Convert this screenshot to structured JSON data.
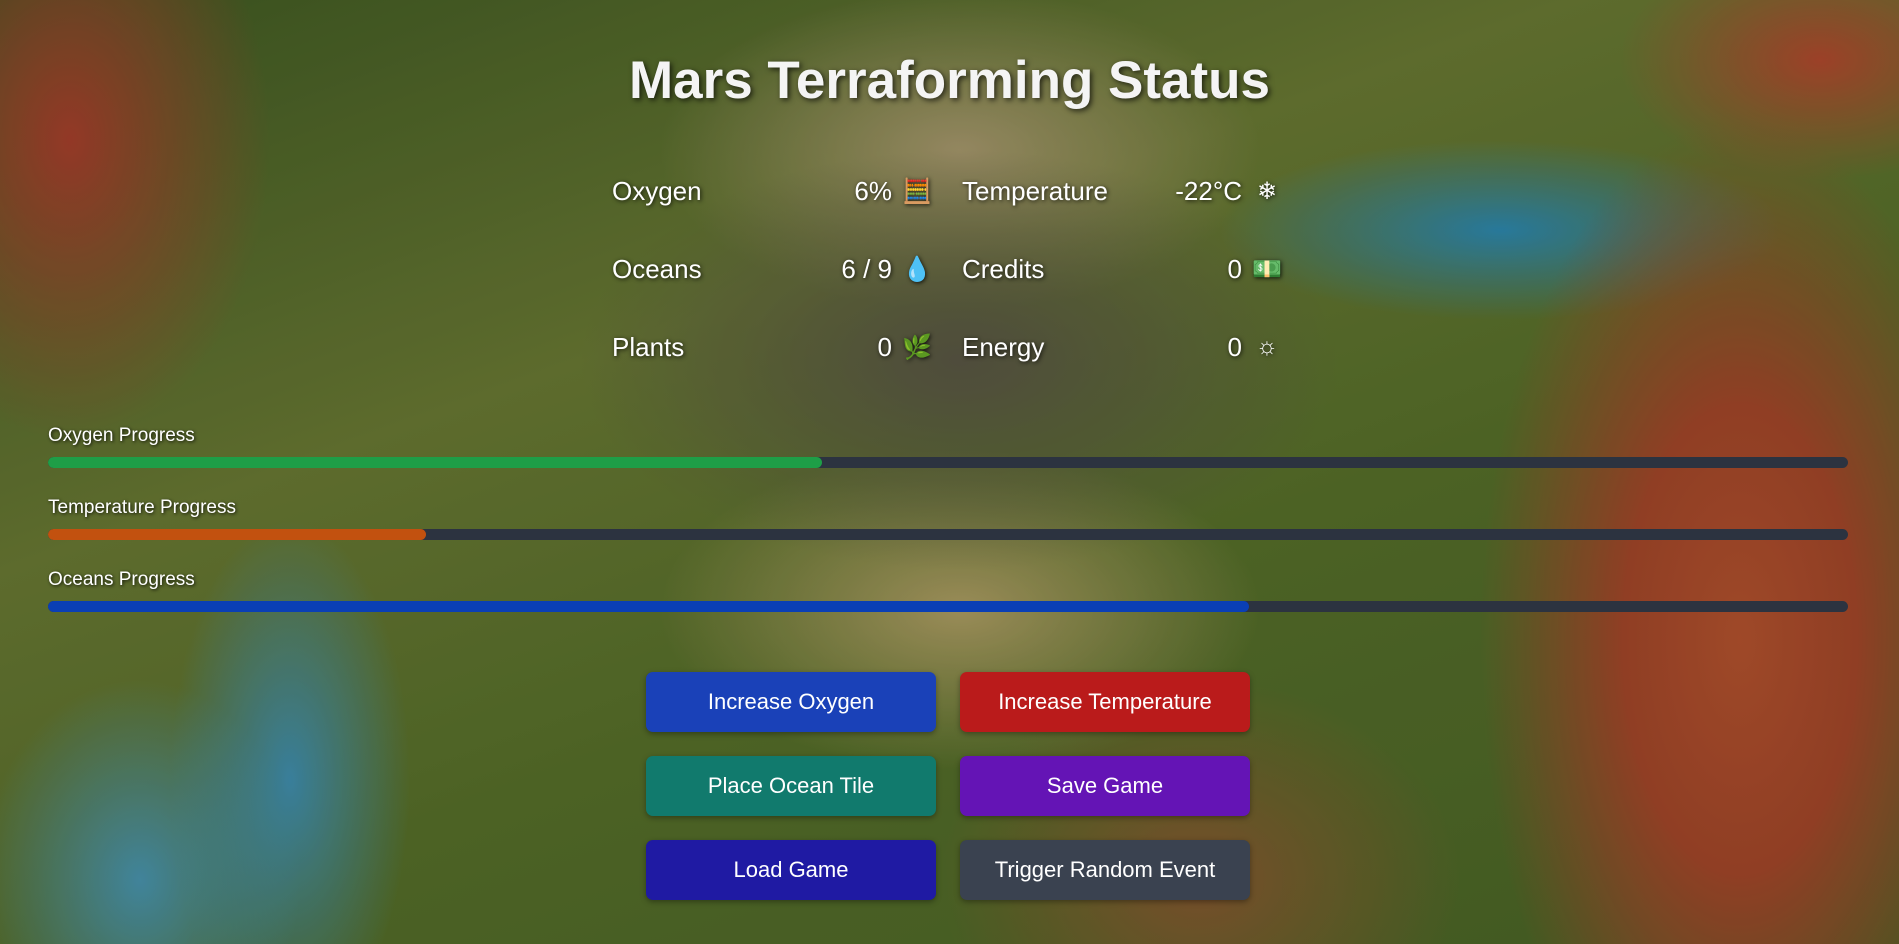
{
  "title": "Mars Terraforming Status",
  "stats": [
    {
      "label": "Oxygen",
      "value": "6%",
      "icon": "🧮",
      "icon_name": "abacus-icon"
    },
    {
      "label": "Temperature",
      "value": "-22°C",
      "icon": "❄",
      "icon_name": "snowflake-icon"
    },
    {
      "label": "Oceans",
      "value": "6 / 9",
      "icon": "💧",
      "icon_name": "droplet-icon"
    },
    {
      "label": "Credits",
      "value": "0",
      "icon": "💵",
      "icon_name": "money-icon"
    },
    {
      "label": "Plants",
      "value": "0",
      "icon": "🌿",
      "icon_name": "herb-icon"
    },
    {
      "label": "Energy",
      "value": "0",
      "icon": "☼",
      "icon_name": "sun-icon"
    }
  ],
  "progress": [
    {
      "label": "Oxygen Progress",
      "fraction": 0.43,
      "color": "#1e9e47"
    },
    {
      "label": "Temperature Progress",
      "fraction": 0.21,
      "color": "#c2510f"
    },
    {
      "label": "Oceans Progress",
      "fraction": 0.667,
      "color": "#0a3fb5"
    }
  ],
  "buttons": [
    {
      "label": "Increase Oxygen",
      "color": "#1a41b8"
    },
    {
      "label": "Increase Temperature",
      "color": "#ba1b1b"
    },
    {
      "label": "Place Ocean Tile",
      "color": "#117a6d"
    },
    {
      "label": "Save Game",
      "color": "#6414b5"
    },
    {
      "label": "Load Game",
      "color": "#1f1aa3"
    },
    {
      "label": "Trigger Random Event",
      "color": "#3a4250"
    }
  ]
}
